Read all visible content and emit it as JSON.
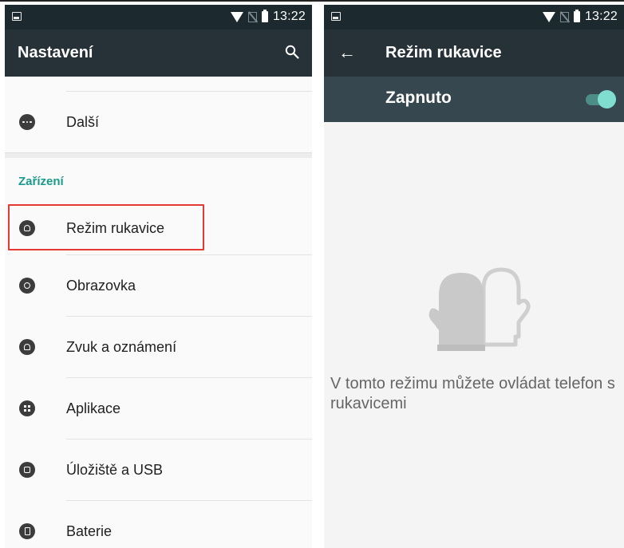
{
  "left_screen": {
    "status_bar": {
      "time": "13:22"
    },
    "toolbar": {
      "title": "Nastavení",
      "search_icon": "search-icon"
    },
    "items_top": [
      {
        "label": "Další",
        "icon": "more-icon"
      }
    ],
    "section": {
      "title": "Zařízení"
    },
    "items": [
      {
        "label": "Režim rukavice",
        "icon": "glove-icon",
        "highlighted": true
      },
      {
        "label": "Obrazovka",
        "icon": "brightness-icon"
      },
      {
        "label": "Zvuk a oznámení",
        "icon": "bell-icon"
      },
      {
        "label": "Aplikace",
        "icon": "apps-icon"
      },
      {
        "label": "Úložiště a USB",
        "icon": "storage-icon"
      },
      {
        "label": "Baterie",
        "icon": "battery-icon"
      }
    ]
  },
  "right_screen": {
    "status_bar": {
      "time": "13:22"
    },
    "toolbar": {
      "title": "Režim rukavice",
      "back_icon": "back-arrow-icon"
    },
    "switch": {
      "label": "Zapnuto",
      "on": true
    },
    "description": "V tomto režimu můžete ovládat telefon s rukavicemi"
  },
  "colors": {
    "statusbar": "#1c2a2f",
    "toolbar": "#263238",
    "switchbar": "#37474f",
    "accent": "#1a9a8a",
    "highlight": "#e53935"
  }
}
